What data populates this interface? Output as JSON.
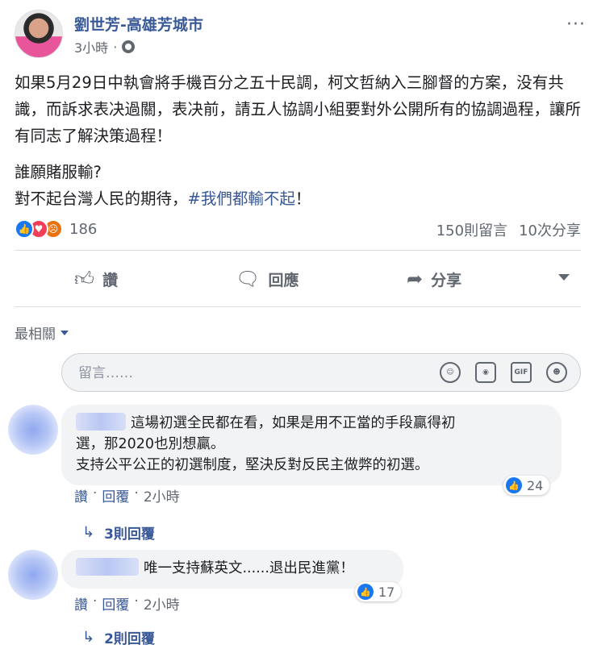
{
  "post": {
    "author": "劉世芳-高雄芳城市",
    "time": "3小時",
    "more": "···",
    "paragraph1": "如果5月29日中執會將手機百分之五十民調，柯文哲納入三腳督的方案，没有共識，而訴求表决過關，表决前，請五人協調小組要對外公開所有的協調過程，讓所有同志了解決策過程！",
    "line2": "誰願賭服輸?",
    "line3_prefix": "對不起台灣人民的期待，",
    "hashtag": "#我們都輸不起",
    "line3_suffix": "！"
  },
  "stats": {
    "reaction_count": "186",
    "comments": "150則留言",
    "shares": "10次分享"
  },
  "actions": {
    "like": "讚",
    "comment": "回應",
    "share": "分享"
  },
  "sort": {
    "label": "最相關"
  },
  "comment_input": {
    "placeholder": "留言……"
  },
  "comments": [
    {
      "text_line1": "這場初選全民都在看，如果是用不正當的手段贏得初",
      "text_line2": "選，那2020也別想贏。",
      "text_line3": "支持公平公正的初選制度，堅決反對反民主做弊的初選。",
      "likes": "24",
      "like_label": "讚",
      "reply_label": "回覆",
      "time": "2小時",
      "replies": "3則回覆"
    },
    {
      "text_line1": "唯一支持蘇英文......退出民進黨！",
      "likes": "17",
      "like_label": "讚",
      "reply_label": "回覆",
      "time": "2小時",
      "replies": "2則回覆"
    }
  ],
  "colors": {
    "link": "#385898",
    "like_blue": "#1877f2",
    "love_red": "#f33e58",
    "angry_orange": "#e9710f",
    "secondary_text": "#606770"
  }
}
